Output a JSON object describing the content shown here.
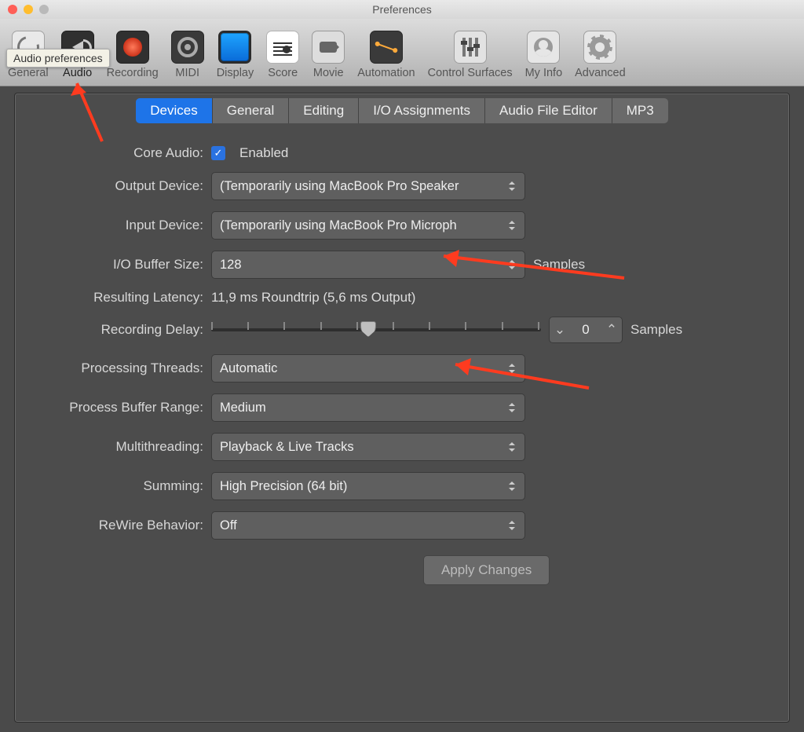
{
  "window": {
    "title": "Preferences"
  },
  "tooltip": "Audio preferences",
  "toolbar": [
    {
      "label": "General",
      "icon": "general"
    },
    {
      "label": "Audio",
      "icon": "audio",
      "active": true
    },
    {
      "label": "Recording",
      "icon": "recording"
    },
    {
      "label": "MIDI",
      "icon": "midi"
    },
    {
      "label": "Display",
      "icon": "display"
    },
    {
      "label": "Score",
      "icon": "score"
    },
    {
      "label": "Movie",
      "icon": "movie"
    },
    {
      "label": "Automation",
      "icon": "automation"
    },
    {
      "label": "Control Surfaces",
      "icon": "surfaces"
    },
    {
      "label": "My Info",
      "icon": "info"
    },
    {
      "label": "Advanced",
      "icon": "advanced"
    }
  ],
  "subtabs": [
    {
      "label": "Devices",
      "active": true
    },
    {
      "label": "General"
    },
    {
      "label": "Editing"
    },
    {
      "label": "I/O Assignments"
    },
    {
      "label": "Audio File Editor"
    },
    {
      "label": "MP3"
    }
  ],
  "form": {
    "core_audio_label": "Core Audio:",
    "core_audio_enabled_text": "Enabled",
    "output_label": "Output Device:",
    "output_value": "(Temporarily using MacBook Pro Speaker",
    "input_label": "Input Device:",
    "input_value": "(Temporarily using MacBook Pro Microph",
    "iobuf_label": "I/O Buffer Size:",
    "iobuf_value": "128",
    "samples_unit": "Samples",
    "latency_label": "Resulting Latency:",
    "latency_value": "11,9 ms Roundtrip (5,6 ms Output)",
    "recdelay_label": "Recording Delay:",
    "recdelay_value": "0",
    "procthreads_label": "Processing Threads:",
    "procthreads_value": "Automatic",
    "procbuf_label": "Process Buffer Range:",
    "procbuf_value": "Medium",
    "multithread_label": "Multithreading:",
    "multithread_value": "Playback & Live Tracks",
    "summing_label": "Summing:",
    "summing_value": "High Precision (64 bit)",
    "rewire_label": "ReWire Behavior:",
    "rewire_value": "Off",
    "apply_label": "Apply Changes"
  }
}
